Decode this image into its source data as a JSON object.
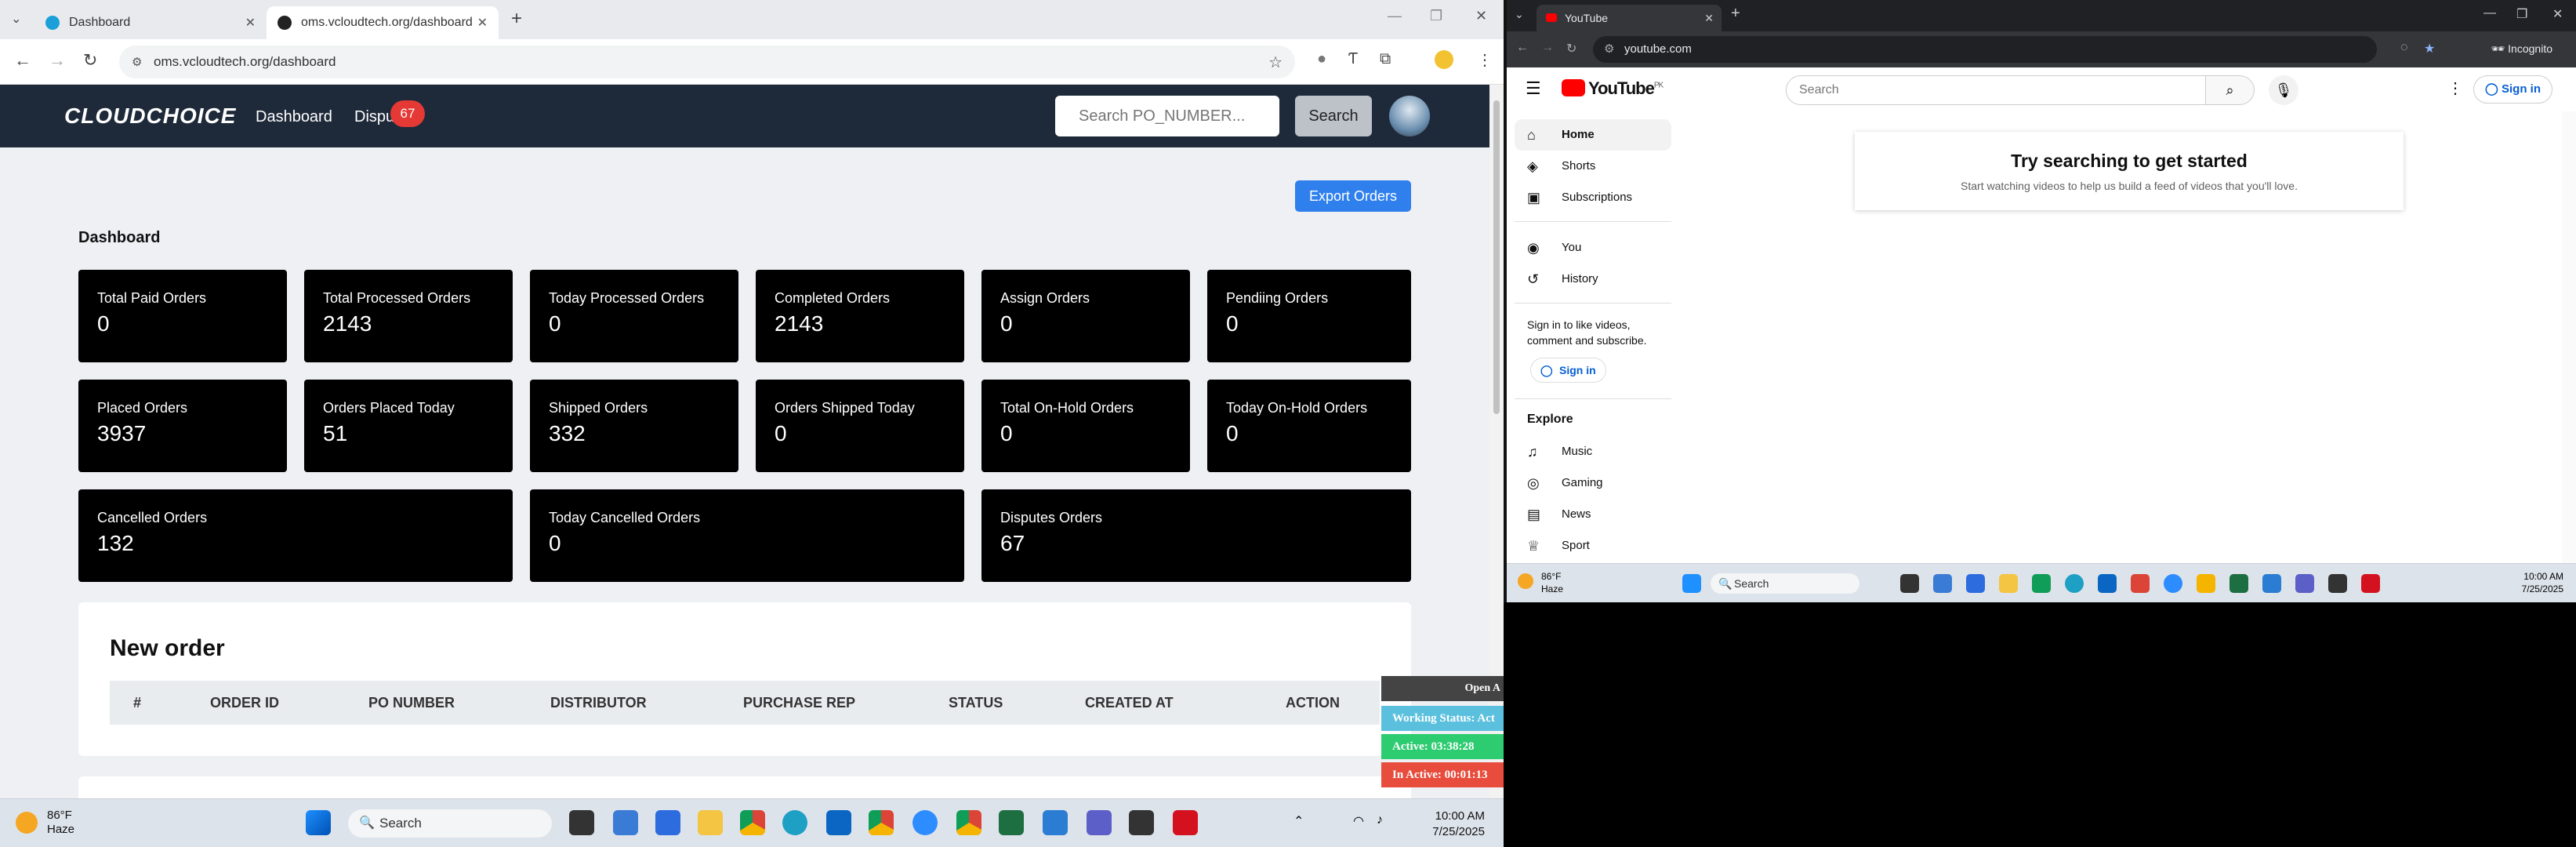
{
  "left_browser": {
    "tabs": [
      {
        "label": "Dashboard",
        "favicon_color": "#1a9fd9"
      },
      {
        "label": "oms.vcloudtech.org/dashboard",
        "favicon_color": "#222222"
      }
    ],
    "url": "oms.vcloudtech.org/dashboard"
  },
  "app": {
    "brand": "CLOUDCHOICE",
    "nav": {
      "dashboard": "Dashboard",
      "disputes": "Dispu",
      "disputes_badge": "67"
    },
    "search_placeholder": "Search PO_NUMBER...",
    "search_button": "Search",
    "export_button": "Export Orders",
    "dashboard_title": "Dashboard",
    "cards": [
      {
        "label": "Total Paid Orders",
        "value": "0"
      },
      {
        "label": "Total Processed Orders",
        "value": "2143"
      },
      {
        "label": "Today Processed Orders",
        "value": "0"
      },
      {
        "label": "Completed Orders",
        "value": "2143"
      },
      {
        "label": "Assign Orders",
        "value": "0"
      },
      {
        "label": "Pendiing Orders",
        "value": "0"
      },
      {
        "label": "Placed Orders",
        "value": "3937"
      },
      {
        "label": "Orders Placed Today",
        "value": "51"
      },
      {
        "label": "Shipped Orders",
        "value": "332"
      },
      {
        "label": "Orders Shipped Today",
        "value": "0"
      },
      {
        "label": "Total On-Hold Orders",
        "value": "0"
      },
      {
        "label": "Today On-Hold Orders",
        "value": "0"
      },
      {
        "label": "Cancelled Orders",
        "value": "132"
      },
      {
        "label": "Today Cancelled Orders",
        "value": "0"
      },
      {
        "label": "Disputes Orders",
        "value": "67"
      }
    ],
    "new_order": {
      "title": "New order",
      "columns": [
        "#",
        "ORDER ID",
        "PO NUMBER",
        "DISTRIBUTOR",
        "PURCHASE REP",
        "STATUS",
        "CREATED AT",
        "ACTION"
      ]
    }
  },
  "status_widget": {
    "open_label": "Open A",
    "working_status": "Working Status: Act",
    "active": "Active: 03:38:28",
    "inactive": "In Active: 00:01:13",
    "colors": {
      "working": "#5bc0de",
      "active": "#2ecc71",
      "inactive": "#e74c3c"
    }
  },
  "taskbar": {
    "weather_temp": "86°F",
    "weather_desc": "Haze",
    "search": "Search",
    "time": "10:00 AM",
    "date": "7/25/2025"
  },
  "right_browser": {
    "tab": "YouTube",
    "url": "youtube.com",
    "incognito": "Incognito",
    "youtube": {
      "logo": "YouTube",
      "region": "PK",
      "search_placeholder": "Search",
      "sign_in": "Sign in",
      "sidebar": {
        "items": [
          "Home",
          "Shorts",
          "Subscriptions",
          "You",
          "History"
        ],
        "signin_prompt": "Sign in to like videos, comment and subscribe.",
        "signin_button": "Sign in",
        "explore_title": "Explore",
        "explore_items": [
          "Music",
          "Gaming",
          "News",
          "Sport"
        ]
      },
      "empty_title": "Try searching to get started",
      "empty_subtitle": "Start watching videos to help us build a feed of videos that you'll love."
    },
    "taskbar": {
      "weather_temp": "86°F",
      "weather_desc": "Haze",
      "search": "Search",
      "time": "10:00 AM",
      "date": "7/25/2025"
    }
  }
}
